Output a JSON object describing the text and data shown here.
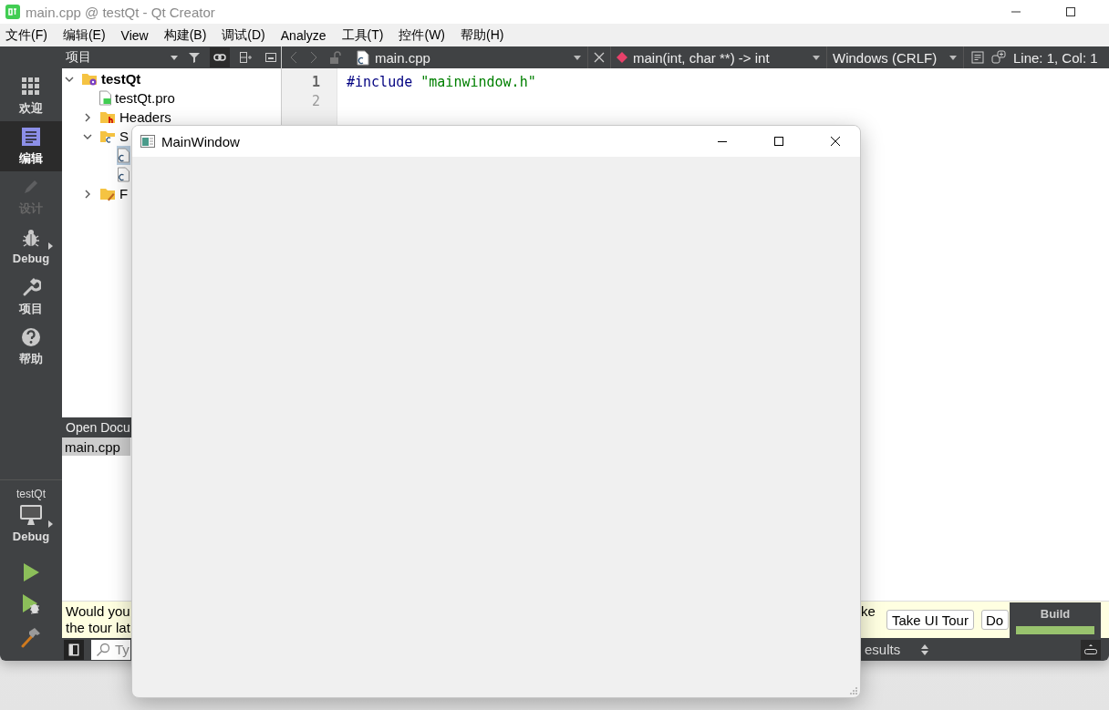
{
  "window": {
    "title": "main.cpp @ testQt - Qt Creator"
  },
  "menu": [
    "文件(F)",
    "编辑(E)",
    "View",
    "构建(B)",
    "调试(D)",
    "Analyze",
    "工具(T)",
    "控件(W)",
    "帮助(H)"
  ],
  "modes": [
    {
      "label": "欢迎",
      "kind": "welcome",
      "selected": false,
      "disabled": false
    },
    {
      "label": "编辑",
      "kind": "edit",
      "selected": true,
      "disabled": false
    },
    {
      "label": "设计",
      "kind": "design",
      "selected": false,
      "disabled": true
    },
    {
      "label": "Debug",
      "kind": "debug",
      "selected": false,
      "disabled": false
    },
    {
      "label": "项目",
      "kind": "projects",
      "selected": false,
      "disabled": false
    },
    {
      "label": "帮助",
      "kind": "help",
      "selected": false,
      "disabled": false
    }
  ],
  "kit": {
    "project": "testQt",
    "build": "Debug"
  },
  "project_pane": {
    "title": "项目",
    "tree": [
      {
        "label": "testQt",
        "kind": "project",
        "expanded": true,
        "children": [
          {
            "label": "testQt.pro",
            "kind": "pro"
          },
          {
            "label": "Headers",
            "kind": "headers",
            "expanded": false
          },
          {
            "label": "S",
            "kind": "sources",
            "expanded": true,
            "children": [
              {
                "kind": "cpp",
                "selected": true
              },
              {
                "kind": "cpp",
                "selected": false
              }
            ]
          },
          {
            "label": "F",
            "kind": "forms",
            "expanded": false
          }
        ]
      }
    ]
  },
  "open_documents": {
    "title": "Open Docu",
    "items": [
      {
        "label": "main.cpp",
        "selected": true
      }
    ]
  },
  "editor": {
    "file": "main.cpp",
    "symbol": "main(int, char **) -> int",
    "line_ending": "Windows (CRLF)",
    "position": "Line: 1, Col: 1",
    "lines": [
      {
        "number": "1",
        "current": true,
        "tokens": [
          {
            "kind": "directive",
            "text": "#include"
          },
          {
            "kind": "string",
            "text": "\"mainwindow.h\""
          }
        ]
      },
      {
        "number": "2",
        "current": false
      }
    ]
  },
  "info_bar": {
    "lines": [
      "Would you",
      "the tour lat"
    ],
    "fragment": "ke",
    "buttons": [
      "Take UI Tour",
      "Do"
    ]
  },
  "output_bar": {
    "search": {
      "placeholder": "Ty"
    },
    "pane": "esults"
  },
  "build_progress": {
    "label": "Build",
    "level": 1
  },
  "app_window": {
    "title": "MainWindow"
  }
}
